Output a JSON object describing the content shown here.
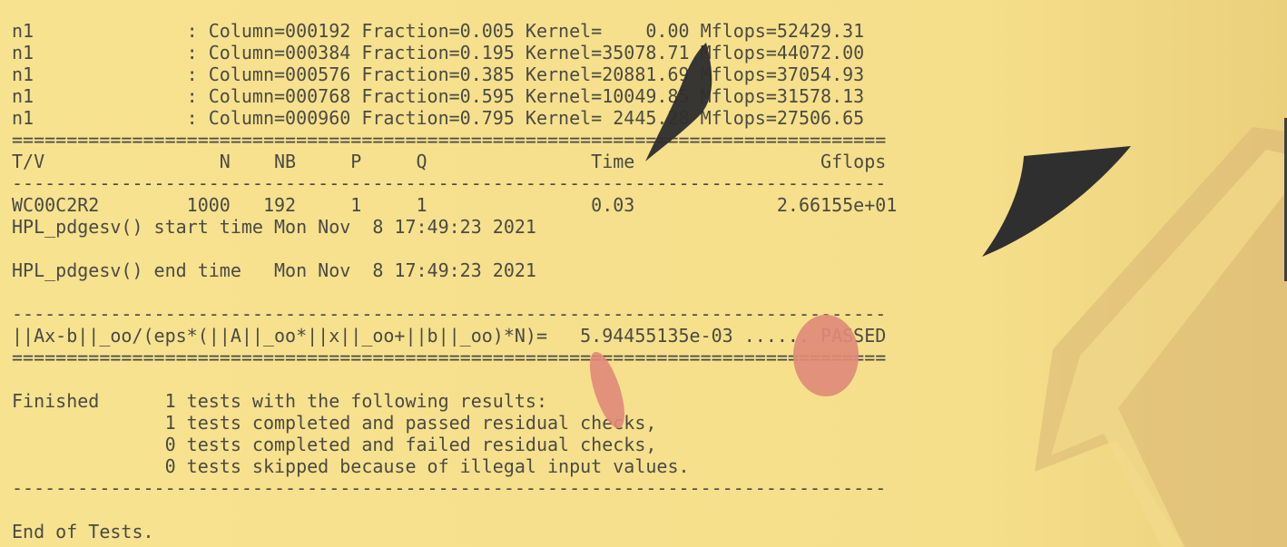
{
  "terminal": {
    "lines": [
      "n1              : Column=000192 Fraction=0.005 Kernel=    0.00 Mflops=52429.31",
      "n1              : Column=000384 Fraction=0.195 Kernel=35078.71 Mflops=44072.00",
      "n1              : Column=000576 Fraction=0.385 Kernel=20881.69 Mflops=37054.93",
      "n1              : Column=000768 Fraction=0.595 Kernel=10049.85 Mflops=31578.13",
      "n1              : Column=000960 Fraction=0.795 Kernel= 2445.28 Mflops=27506.65",
      "================================================================================",
      "T/V                N    NB     P     Q               Time                 Gflops",
      "--------------------------------------------------------------------------------",
      "WC00C2R2        1000   192     1     1               0.03             2.66155e+01",
      "HPL_pdgesv() start time Mon Nov  8 17:49:23 2021",
      "",
      "HPL_pdgesv() end time   Mon Nov  8 17:49:23 2021",
      "",
      "--------------------------------------------------------------------------------",
      "||Ax-b||_oo/(eps*(||A||_oo*||x||_oo+||b||_oo)*N)=   5.94455135e-03 ...... PASSED",
      "================================================================================",
      "",
      "Finished      1 tests with the following results:",
      "              1 tests completed and passed residual checks,",
      "              0 tests completed and failed residual checks,",
      "              0 tests skipped because of illegal input values.",
      "--------------------------------------------------------------------------------",
      "",
      "End of Tests."
    ]
  },
  "colors": {
    "background": "#f6e08e",
    "text": "#4b4a44",
    "accent_dark": "#2f2f2f",
    "accent_red": "#e08a78",
    "stripe": "#d8b774"
  }
}
